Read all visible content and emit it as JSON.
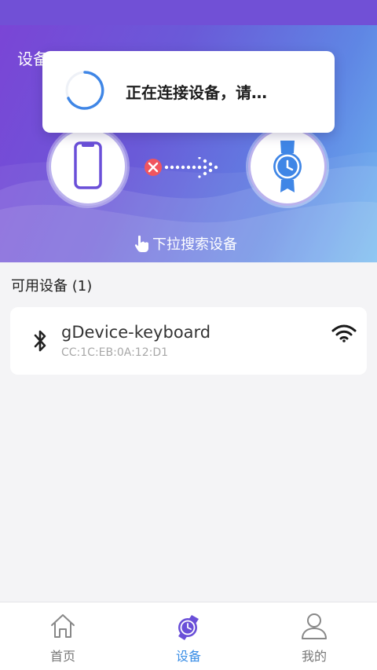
{
  "header": {
    "title": "设备"
  },
  "connect": {
    "pull_hint": "下拉搜索设备"
  },
  "toast": {
    "message": "正在连接设备，请…"
  },
  "devices_section": {
    "title": "可用设备 (1)"
  },
  "devices": [
    {
      "name": "gDevice-keyboard",
      "mac": "CC:1C:EB:0A:12:D1"
    }
  ],
  "tabs": [
    {
      "label": "首页",
      "icon": "home-icon"
    },
    {
      "label": "设备",
      "icon": "watch-icon",
      "active": true
    },
    {
      "label": "我的",
      "icon": "user-icon"
    }
  ],
  "colors": {
    "accent": "#3a8ee6",
    "hero_start": "#7a45d6",
    "hero_end": "#6fb8f0",
    "device_purple": "#6a4fd8",
    "watch_blue": "#3f86e6",
    "disconnect_red": "#f0555f"
  }
}
